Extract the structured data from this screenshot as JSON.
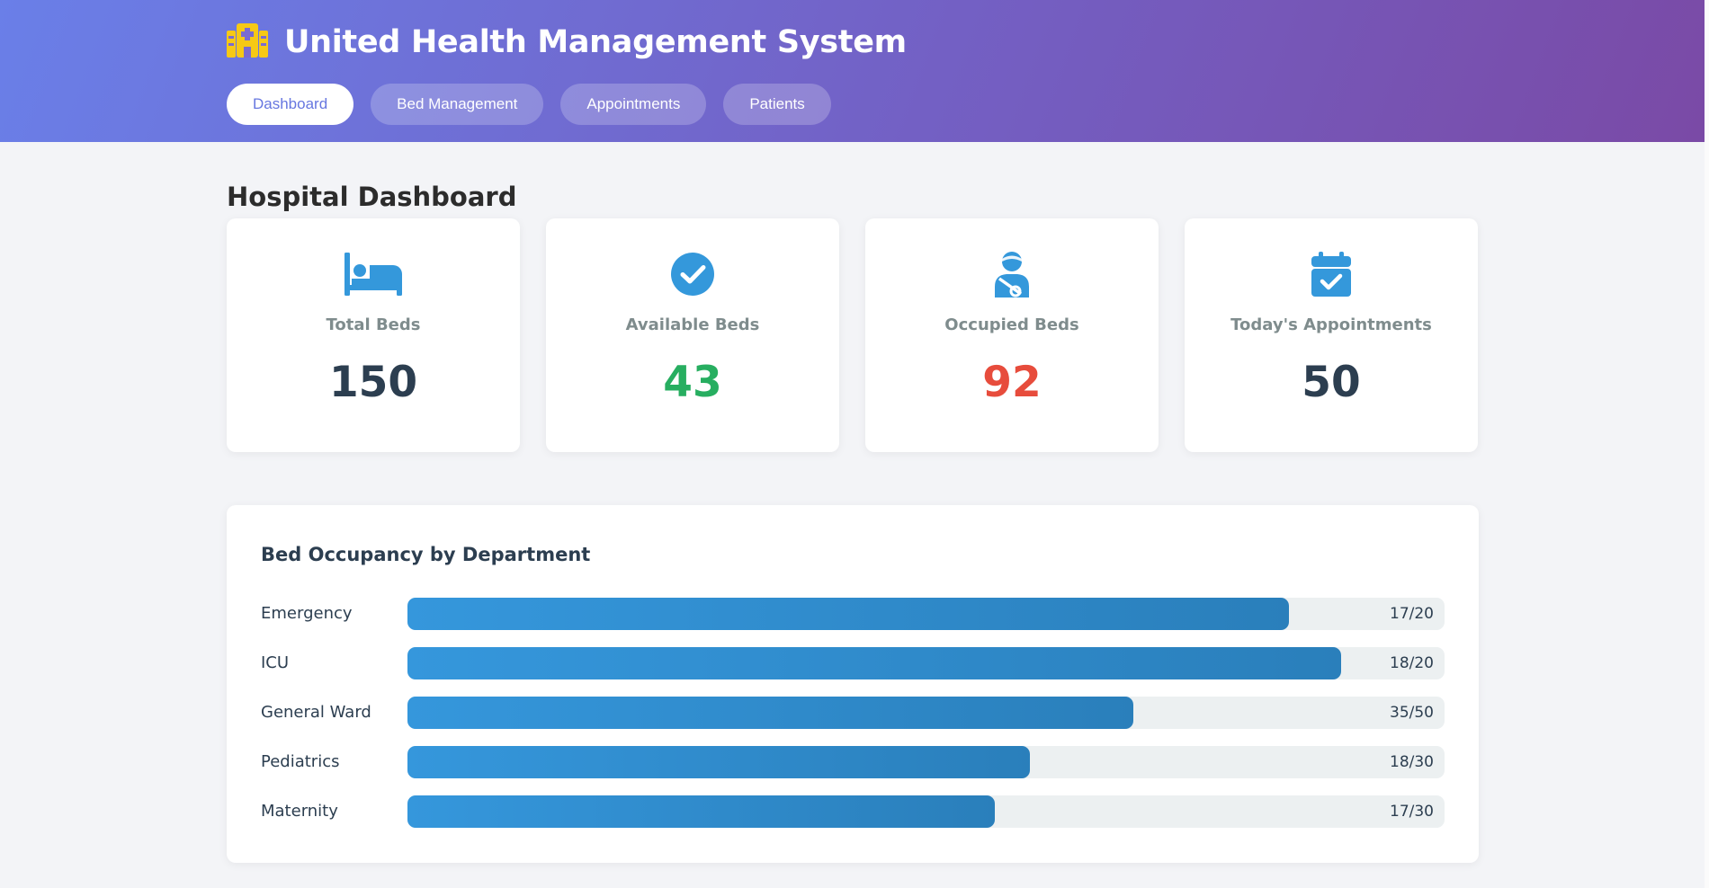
{
  "header": {
    "title": "United Health Management System",
    "logo_icon": "hospital-icon",
    "tabs": [
      {
        "label": "Dashboard",
        "active": true
      },
      {
        "label": "Bed Management",
        "active": false
      },
      {
        "label": "Appointments",
        "active": false
      },
      {
        "label": "Patients",
        "active": false
      }
    ]
  },
  "main": {
    "title": "Hospital Dashboard",
    "stats": [
      {
        "label": "Total Beds",
        "value": "150",
        "icon": "bed-icon",
        "color": "#2c3e50"
      },
      {
        "label": "Available Beds",
        "value": "43",
        "icon": "check-circle-icon",
        "color": "#27ae60"
      },
      {
        "label": "Occupied Beds",
        "value": "92",
        "icon": "injured-patient-icon",
        "color": "#e74c3c"
      },
      {
        "label": "Today's Appointments",
        "value": "50",
        "icon": "calendar-check-icon",
        "color": "#2c3e50"
      }
    ],
    "occupancy": {
      "title": "Bed Occupancy by Department",
      "rows": [
        {
          "department": "Emergency",
          "occupied": 17,
          "total": 20,
          "text": "17/20"
        },
        {
          "department": "ICU",
          "occupied": 18,
          "total": 20,
          "text": "18/20"
        },
        {
          "department": "General Ward",
          "occupied": 35,
          "total": 50,
          "text": "35/50"
        },
        {
          "department": "Pediatrics",
          "occupied": 18,
          "total": 30,
          "text": "18/30"
        },
        {
          "department": "Maternity",
          "occupied": 17,
          "total": 30,
          "text": "17/30"
        }
      ]
    }
  },
  "colors": {
    "accent": "#3498db",
    "logo": "#f6c915",
    "available": "#27ae60",
    "occupied": "#e74c3c"
  }
}
